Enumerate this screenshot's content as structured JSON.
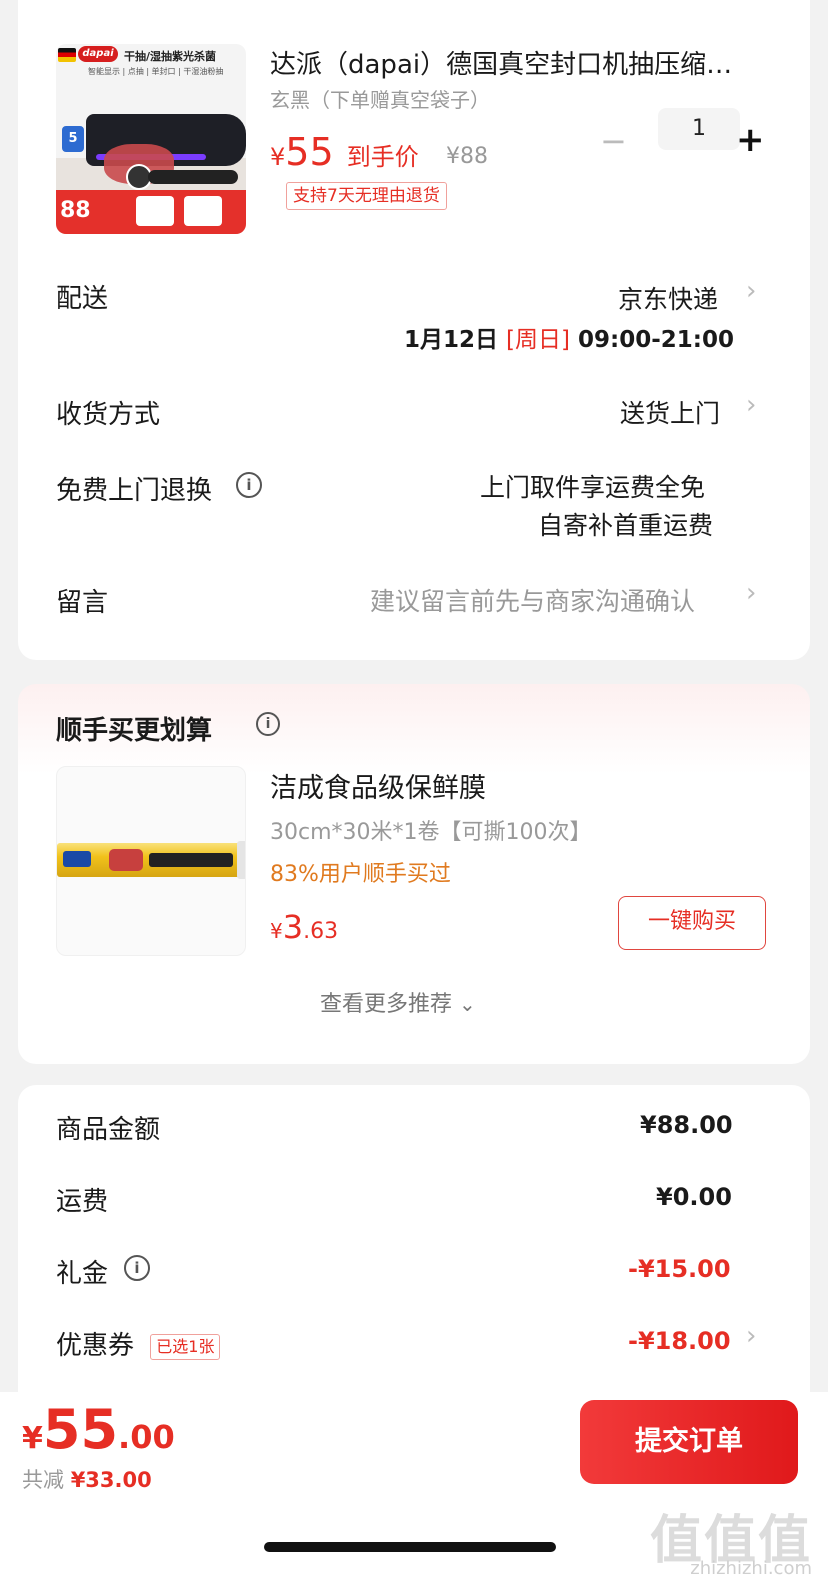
{
  "product": {
    "title": "达派（dapai）德国真空封口机抽压缩…",
    "variant": "玄黑（下单赠真空袋子）",
    "currency": "¥",
    "price": "55",
    "price_label": "到手价",
    "orig_price": "¥88",
    "qty": "1",
    "minus": "−",
    "plus": "+",
    "return_tag": "支持7天无理由退货",
    "thumb": {
      "brand": "dapai",
      "headline": "干抽/湿抽紫光杀菌",
      "sub": "智能显示 | 点抽 | 单封口 | 干湿油粉抽",
      "badge": "5",
      "promo_price": "88"
    }
  },
  "delivery": {
    "label": "配送",
    "carrier": "京东快递",
    "date": "1月12日",
    "weekday": "[周日]",
    "time": "09:00-21:00"
  },
  "receive": {
    "label": "收货方式",
    "value": "送货上门"
  },
  "free_return": {
    "label": "免费上门退换",
    "info": "i",
    "line1": "上门取件享运费全免",
    "line2": "自寄补首重运费"
  },
  "message": {
    "label": "留言",
    "placeholder": "建议留言前先与商家沟通确认"
  },
  "addon": {
    "title": "顺手买更划算",
    "info": "i",
    "item": {
      "name": "洁成食品级保鲜膜",
      "spec": "30cm*30米*1卷【可撕100次】",
      "buyers": "83%用户顺手买过",
      "currency": "¥",
      "price_int": "3",
      "price_dec": ".63",
      "buy_button": "一键购买"
    },
    "more": "查看更多推荐",
    "more_icon": "⌄"
  },
  "summary": {
    "goods_label": "商品金额",
    "goods_value": "¥88.00",
    "shipping_label": "运费",
    "shipping_value": "¥0.00",
    "gift_label": "礼金",
    "gift_info": "i",
    "gift_value": "-¥15.00",
    "coupon_label": "优惠券",
    "coupon_tag": "已选1张",
    "coupon_value": "-¥18.00"
  },
  "bottom": {
    "currency": "¥",
    "total_int": "55",
    "total_dec": ".00",
    "saved_label": "共减",
    "saved_value": "¥33.00",
    "submit": "提交订单"
  },
  "chevron": "›",
  "watermark": "值值值",
  "watermark_sub": "zhizhizhi.com",
  "colors": {
    "accent": "#e62e24",
    "orange": "#e07a1f",
    "background": "#f2f2f2"
  }
}
